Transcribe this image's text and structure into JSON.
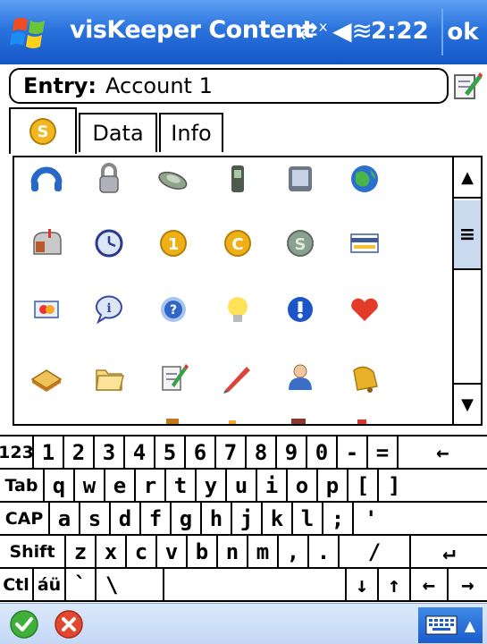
{
  "titlebar": {
    "app_title": "visKeeper Content",
    "time": "2:22",
    "ok_label": "ok",
    "start_icon": "windows-flag-icon",
    "sync_icon": "sync-disconnected-icon",
    "speaker_icon": "speaker-icon",
    "accent_color": "#2a73dd"
  },
  "entry": {
    "label": "Entry:",
    "value": "Account 1",
    "edit_icon": "edit-note-icon"
  },
  "tabs": [
    {
      "label": "",
      "icon": "coin-icon",
      "active": true
    },
    {
      "label": "Data",
      "active": false
    },
    {
      "label": "Info",
      "active": false
    }
  ],
  "icons": [
    [
      "headset-icon",
      "padlock-icon",
      "cash-icon",
      "cellphone-icon",
      "pda-icon",
      "globe-icon"
    ],
    [
      "mailbox-icon",
      "clock-icon",
      "gold-coin-1-icon",
      "gold-coin-c-icon",
      "silver-coin-icon",
      "credit-card-icon"
    ],
    [
      "mastercard-icon",
      "info-bubble-icon",
      "help-icon",
      "lightbulb-icon",
      "exclamation-icon",
      "heart-icon"
    ],
    [
      "book-icon",
      "folder-icon",
      "notepad-icon",
      "pencil-icon",
      "user-icon",
      "bell-icon"
    ]
  ],
  "keyboard": {
    "rows": [
      [
        "123",
        "1",
        "2",
        "3",
        "4",
        "5",
        "6",
        "7",
        "8",
        "9",
        "0",
        "-",
        "=",
        "←"
      ],
      [
        "Tab",
        "q",
        "w",
        "e",
        "r",
        "t",
        "y",
        "u",
        "i",
        "o",
        "p",
        "[",
        "]"
      ],
      [
        "CAP",
        "a",
        "s",
        "d",
        "f",
        "g",
        "h",
        "j",
        "k",
        "l",
        ";",
        "'"
      ],
      [
        "Shift",
        "z",
        "x",
        "c",
        "v",
        "b",
        "n",
        "m",
        ",",
        ".",
        "/",
        "↵"
      ],
      [
        "Ctl",
        "áü",
        "`",
        "\\",
        " ",
        "↓",
        "↑",
        "←",
        "→"
      ]
    ]
  },
  "bottombar": {
    "ok_icon": "green-check-icon",
    "cancel_icon": "red-x-icon",
    "keyboard_icon": "keyboard-icon"
  }
}
